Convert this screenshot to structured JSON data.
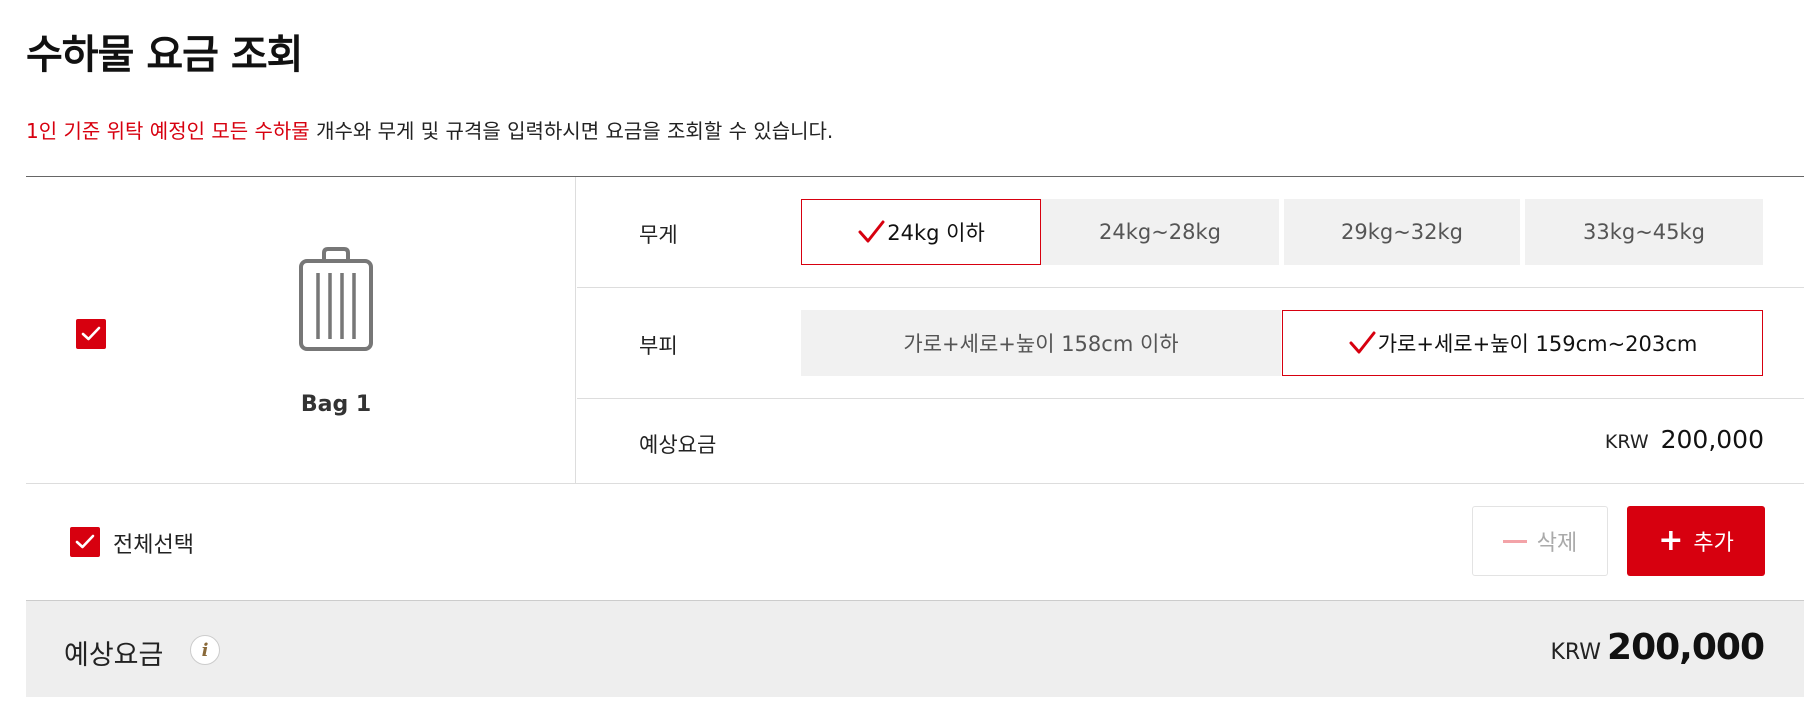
{
  "page": {
    "title": "수하물 요금 조회",
    "intro_highlight": "1인 기준 위탁 예정인 모든 수하물",
    "intro_rest": " 개수와 무게 및 규격을 입력하시면 요금을 조회할 수 있습니다."
  },
  "bag": {
    "name": "Bag 1",
    "checked": true,
    "weight": {
      "label": "무게",
      "options": [
        "24kg 이하",
        "24kg~28kg",
        "29kg~32kg",
        "33kg~45kg"
      ],
      "selected": "24kg 이하"
    },
    "volume": {
      "label": "부피",
      "options": [
        "가로+세로+높이 158cm 이하",
        "가로+세로+높이 159cm~203cm"
      ],
      "selected": "가로+세로+높이 159cm~203cm"
    },
    "price": {
      "label": "예상요금",
      "currency": "KRW",
      "amount": "200,000"
    }
  },
  "actions": {
    "select_all_label": "전체선택",
    "delete_label": "삭제",
    "add_label": "추가"
  },
  "total": {
    "label": "예상요금",
    "info_icon": "i",
    "currency": "KRW",
    "amount": "200,000"
  },
  "colors": {
    "accent": "#d7000f",
    "option_bg": "#f1f1f1",
    "total_bg": "#eeeeee"
  },
  "icons": [
    "luggage-icon",
    "check-icon",
    "checkmark-icon",
    "minus-icon",
    "plus-icon",
    "info-icon"
  ]
}
